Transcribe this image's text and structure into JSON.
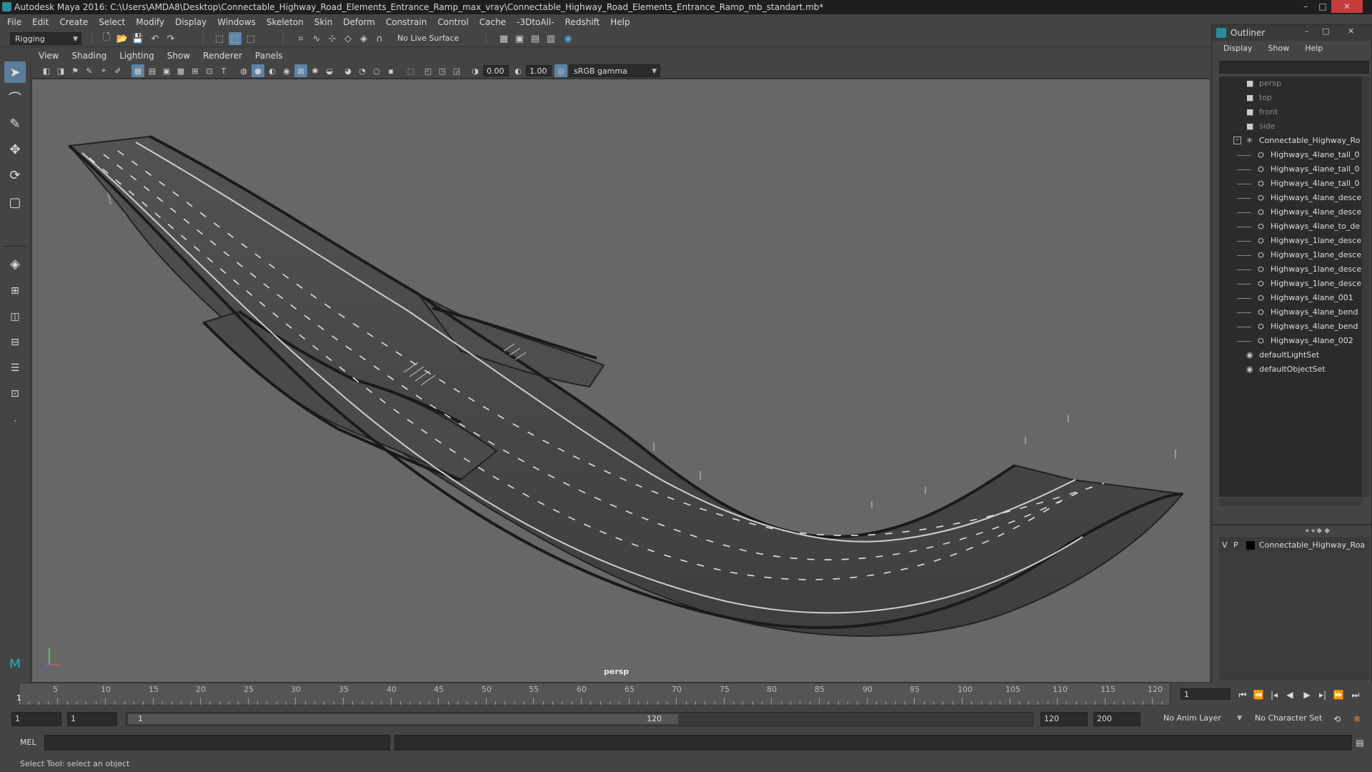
{
  "titlebar": {
    "title": "Autodesk Maya 2016: C:\\Users\\AMDA8\\Desktop\\Connectable_Highway_Road_Elements_Entrance_Ramp_max_vray\\Connectable_Highway_Road_Elements_Entrance_Ramp_mb_standart.mb*",
    "minimize": "–",
    "maximize": "□",
    "close": "✕"
  },
  "menubar": [
    "File",
    "Edit",
    "Create",
    "Select",
    "Modify",
    "Display",
    "Windows",
    "Skeleton",
    "Skin",
    "Deform",
    "Constrain",
    "Control",
    "Cache",
    "-3DtoAll-",
    "Redshift",
    "Help"
  ],
  "statusline": {
    "mode": "Rigging",
    "live_surface": "No Live Surface"
  },
  "panel": {
    "menu": [
      "View",
      "Shading",
      "Lighting",
      "Show",
      "Renderer",
      "Panels"
    ],
    "exposure": "0.00",
    "gamma": "1.00",
    "color_space": "sRGB gamma",
    "camera": "persp"
  },
  "outliner": {
    "title": "Outliner",
    "menu": [
      "Display",
      "Show",
      "Help"
    ],
    "cameras": [
      "persp",
      "top",
      "front",
      "side"
    ],
    "group": "Connectable_Highway_Ro",
    "children": [
      "Highways_4lane_tall_0",
      "Highways_4lane_tall_0",
      "Highways_4lane_tall_0",
      "Highways_4lane_desce",
      "Highways_4lane_desce",
      "Highways_4lane_to_de",
      "Highways_1lane_desce",
      "Highways_1lane_desce",
      "Highways_1lane_desce",
      "Highways_1lane_desce",
      "Highways_4lane_001",
      "Highways_4lane_bend",
      "Highways_4lane_bend",
      "Highways_4lane_002"
    ],
    "sets": [
      "defaultLightSet",
      "defaultObjectSet"
    ]
  },
  "layers": {
    "v": "V",
    "p": "P",
    "layer_name": "Connectable_Highway_Roa"
  },
  "timeline": {
    "ticks": [
      "5",
      "10",
      "15",
      "20",
      "25",
      "30",
      "35",
      "40",
      "45",
      "50",
      "55",
      "60",
      "65",
      "70",
      "75",
      "80",
      "85",
      "90",
      "95",
      "100",
      "105",
      "110",
      "115",
      "120"
    ],
    "start_marker": "1",
    "current_frame": "1"
  },
  "range": {
    "start": "1",
    "playback_start": "1",
    "slider_start": "1",
    "slider_end": "120",
    "playback_end": "120",
    "end": "200",
    "anim_layer": "No Anim Layer",
    "character_set": "No Character Set"
  },
  "cmdline": {
    "label": "MEL"
  },
  "helpline": {
    "text": "Select Tool: select an object"
  },
  "colors": {
    "viewport_bg": "#676767",
    "accent": "#5e84a7",
    "road": "#4a4a4a"
  }
}
